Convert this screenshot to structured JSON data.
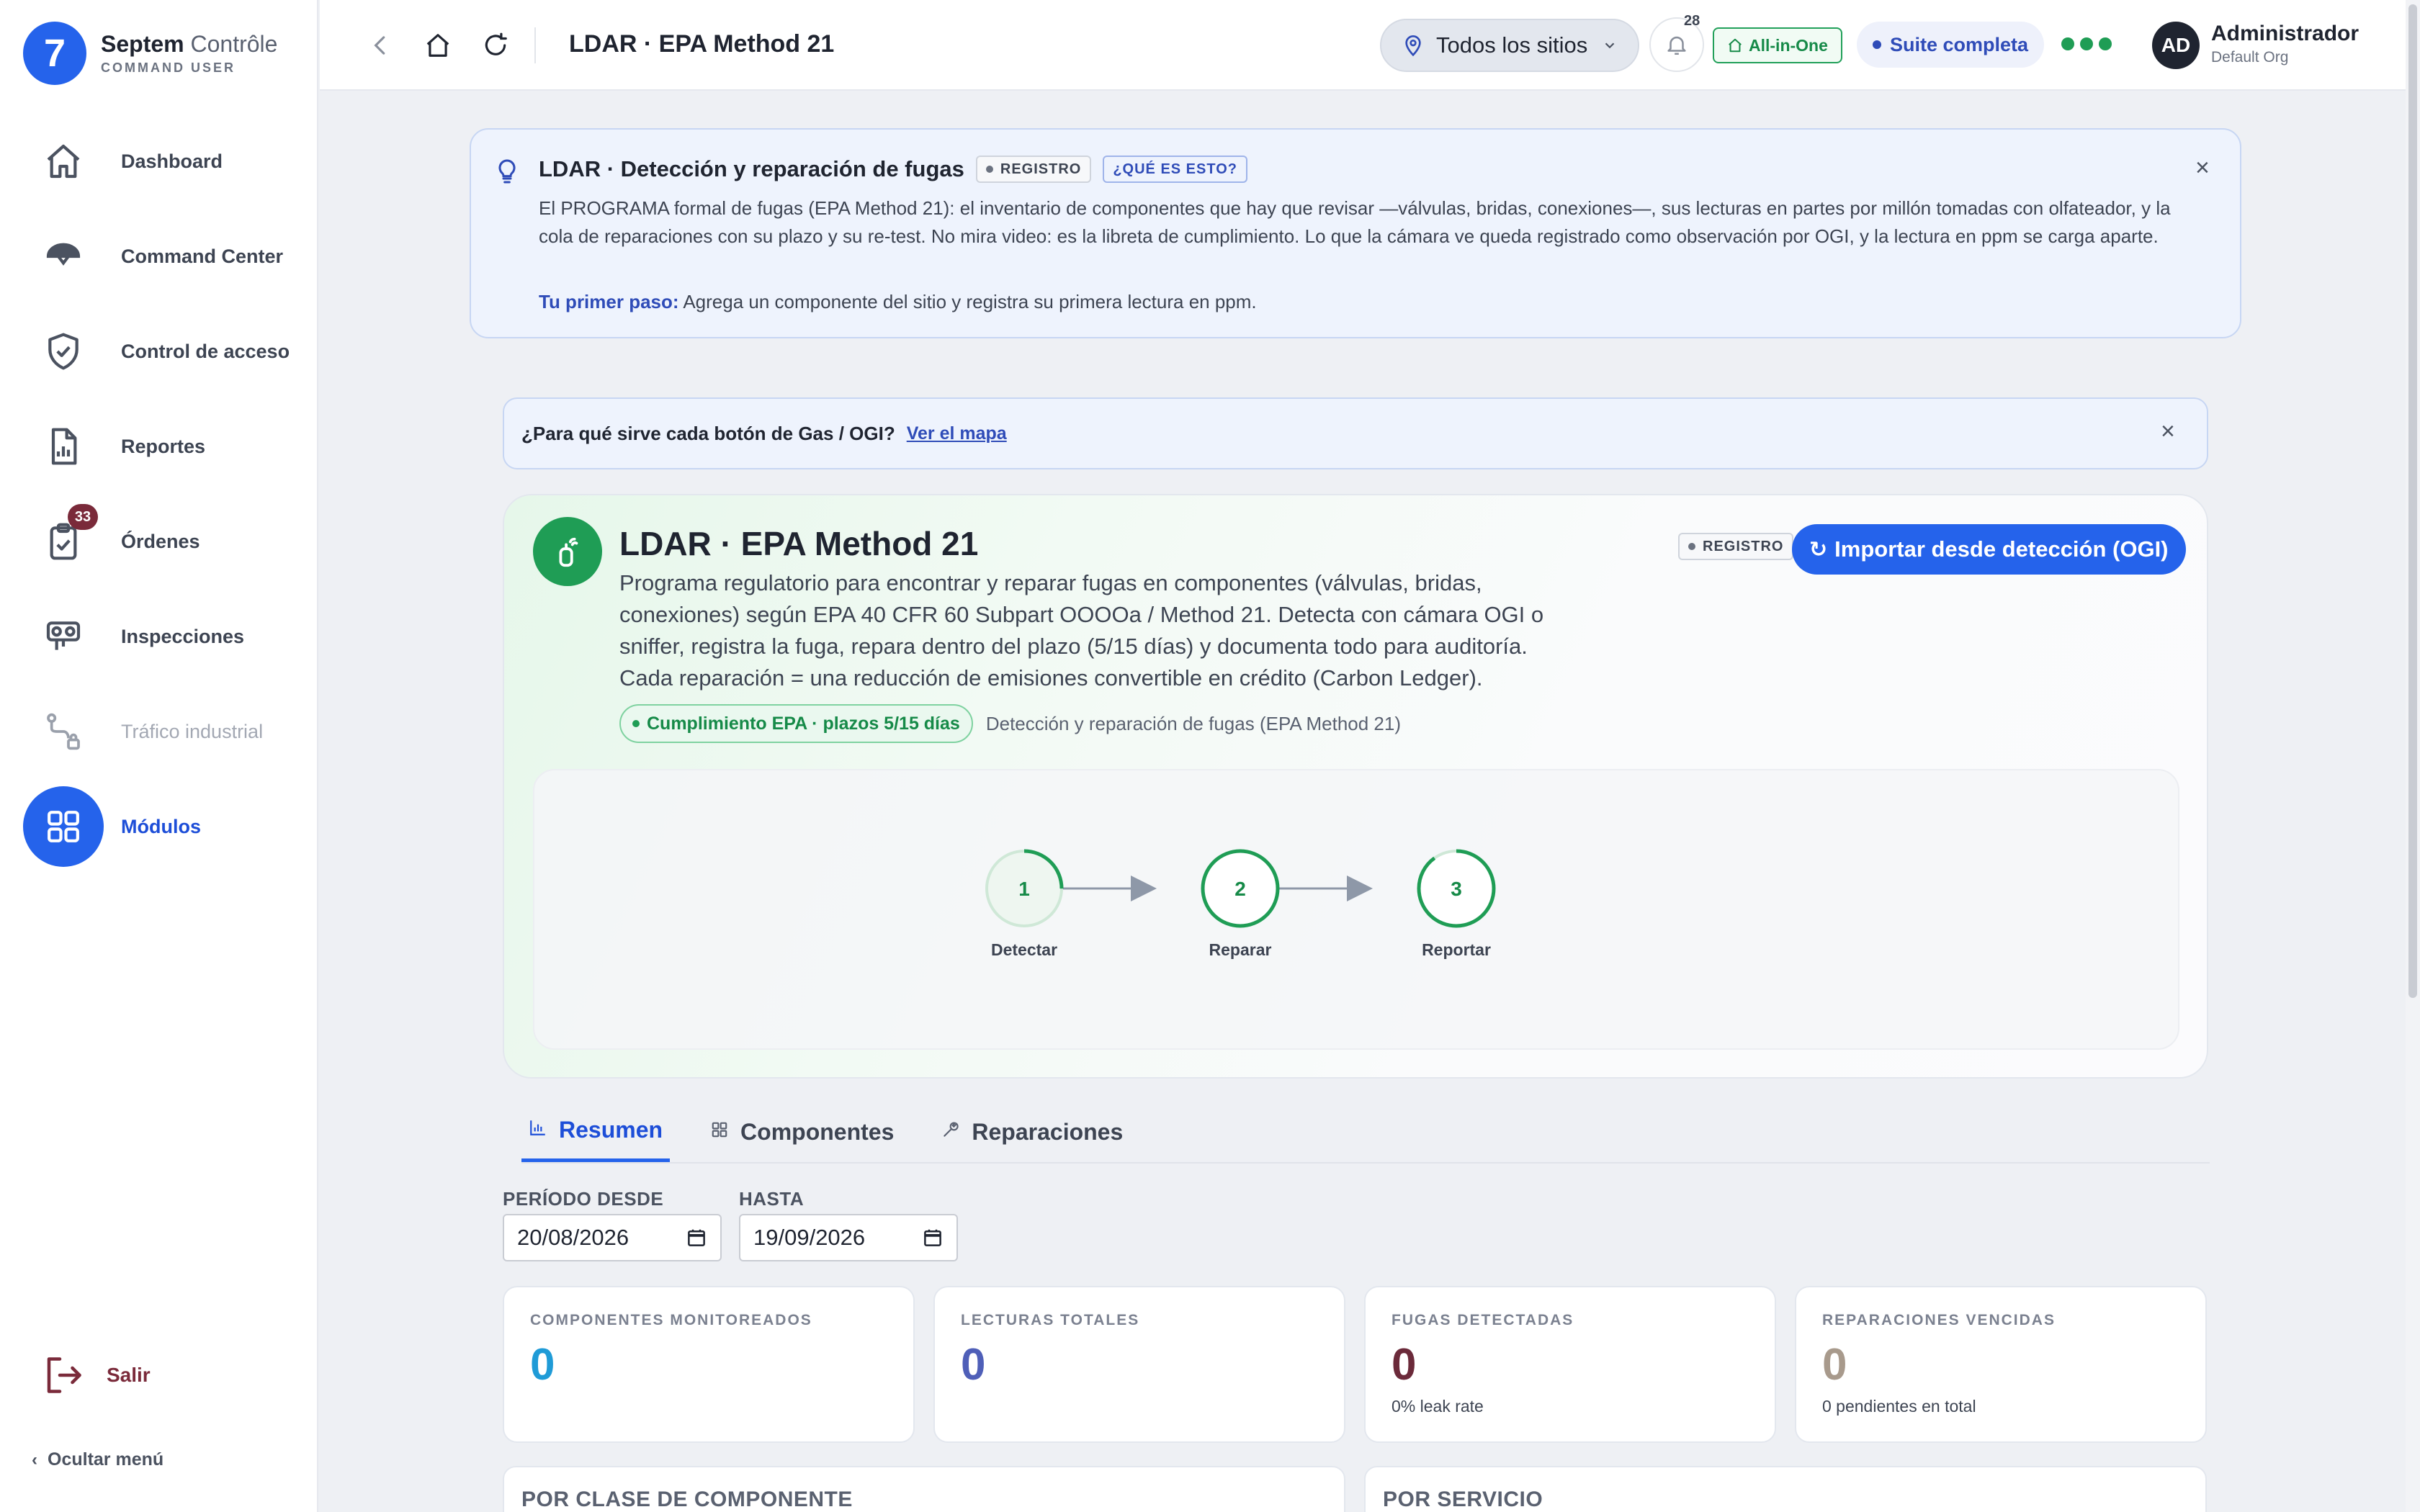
{
  "brand": {
    "logo_char": "7",
    "name_bold": "Septem",
    "name_light": "Contrôle",
    "subtitle": "COMMAND USER"
  },
  "sidebar": {
    "items": [
      {
        "label": "Dashboard",
        "icon": "home-icon"
      },
      {
        "label": "Command Center",
        "icon": "dome-icon"
      },
      {
        "label": "Control de acceso",
        "icon": "shield-icon"
      },
      {
        "label": "Reportes",
        "icon": "report-icon"
      },
      {
        "label": "Órdenes",
        "icon": "clipboard-icon",
        "badge": "33"
      },
      {
        "label": "Inspecciones",
        "icon": "inspection-icon"
      },
      {
        "label": "Tráfico industrial",
        "icon": "route-lock-icon"
      },
      {
        "label": "Módulos",
        "icon": "grid-icon"
      }
    ],
    "logout_label": "Salir",
    "hide_menu_label": "Ocultar menú"
  },
  "topbar": {
    "title": "LDAR · EPA Method 21",
    "site_select": "Todos los sitios",
    "notifications_count": "28",
    "plan_badge": "All-in-One",
    "suite_label": "Suite completa",
    "user_initials": "AD",
    "user_name": "Administrador",
    "user_org": "Default Org"
  },
  "info_banner": {
    "title": "LDAR · Detección y reparación de fugas",
    "tag_registro": "REGISTRO",
    "tag_que_es": "¿QUÉ ES ESTO?",
    "body": "El PROGRAMA formal de fugas (EPA Method 21): el inventario de componentes que hay que revisar —válvulas, bridas, conexiones—, sus lecturas en partes por millón tomadas con olfateador, y la cola de reparaciones con su plazo y su re-test. No mira video: es la libreta de cumplimiento. Lo que la cámara ve queda registrado como observación por OGI, y la lectura en ppm se carga aparte.",
    "first_step_label": "Tu primer paso:",
    "first_step_text": "Agrega un componente del sitio y registra su primera lectura en ppm."
  },
  "map_banner": {
    "question": "¿Para qué sirve cada botón de Gas / OGI?",
    "link": "Ver el mapa"
  },
  "module": {
    "title": "LDAR · EPA Method 21",
    "description": "Programa regulatorio para encontrar y reparar fugas en componentes (válvulas, bridas, conexiones) según EPA 40 CFR 60 Subpart OOOOa / Method 21. Detecta con cámara OGI o sniffer, registra la fuga, repara dentro del plazo (5/15 días) y documenta todo para auditoría. Cada reparación = una reducción de emisiones convertible en crédito (Carbon Ledger).",
    "compliance_pill": "Cumplimiento EPA · plazos 5/15 días",
    "subtitle": "Detección y reparación de fugas (EPA Method 21)",
    "tag": "REGISTRO",
    "import_button": "Importar desde detección (OGI)",
    "steps": [
      {
        "number": "1",
        "label": "Detectar",
        "progress": 0.25
      },
      {
        "number": "2",
        "label": "Reparar",
        "progress": 1.0
      },
      {
        "number": "3",
        "label": "Reportar",
        "progress": 0.9
      }
    ]
  },
  "tabs": [
    {
      "label": "Resumen",
      "icon": "chart-icon",
      "active": true
    },
    {
      "label": "Componentes",
      "icon": "grid-icon",
      "active": false
    },
    {
      "label": "Reparaciones",
      "icon": "wrench-icon",
      "active": false
    }
  ],
  "period": {
    "from_label": "PERÍODO DESDE",
    "from_value": "20/08/2026",
    "to_label": "HASTA",
    "to_value": "19/09/2026"
  },
  "stats": [
    {
      "label": "COMPONENTES MONITOREADOS",
      "value": "0",
      "sub": "",
      "color": "#1f9bd7"
    },
    {
      "label": "LECTURAS TOTALES",
      "value": "0",
      "sub": "",
      "color": "#4f5fb8"
    },
    {
      "label": "FUGAS DETECTADAS",
      "value": "0",
      "sub": "0% leak rate",
      "color": "#6b2a3a"
    },
    {
      "label": "REPARACIONES VENCIDAS",
      "value": "0",
      "sub": "0 pendientes en total",
      "color": "#a89a8c"
    }
  ],
  "sections": {
    "by_class": "POR CLASE DE COMPONENTE",
    "by_service": "POR SERVICIO"
  },
  "colors": {
    "primary": "#2563eb",
    "green": "#1f9d55",
    "badge": "#7a2a3a"
  }
}
